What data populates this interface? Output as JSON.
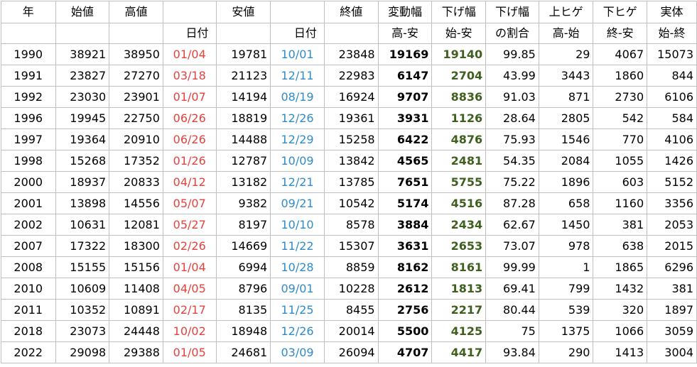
{
  "header": {
    "row1": [
      "年",
      "始値",
      "高値",
      "",
      "安値",
      "",
      "終値",
      "変動幅",
      "下げ幅",
      "下げ幅",
      "上ヒゲ",
      "下ヒゲ",
      "実体"
    ],
    "row2": [
      "",
      "",
      "",
      "日付",
      "",
      "日付",
      "",
      "高-安",
      "始-安",
      "の割合",
      "高-始",
      "終-安",
      "始-終"
    ]
  },
  "rows": [
    [
      "1990",
      "38921",
      "38950",
      "01/04",
      "19781",
      "10/01",
      "23848",
      "19169",
      "19140",
      "99.85",
      "29",
      "4067",
      "15073"
    ],
    [
      "1991",
      "23827",
      "27270",
      "03/18",
      "21123",
      "12/11",
      "22983",
      "6147",
      "2704",
      "43.99",
      "3443",
      "1860",
      "844"
    ],
    [
      "1992",
      "23030",
      "23901",
      "01/07",
      "14194",
      "08/19",
      "16924",
      "9707",
      "8836",
      "91.03",
      "871",
      "2730",
      "6106"
    ],
    [
      "1996",
      "19945",
      "22750",
      "06/26",
      "18819",
      "12/26",
      "19361",
      "3931",
      "1126",
      "28.64",
      "2805",
      "542",
      "584"
    ],
    [
      "1997",
      "19364",
      "20910",
      "06/26",
      "14488",
      "12/29",
      "15258",
      "6422",
      "4876",
      "75.93",
      "1546",
      "770",
      "4106"
    ],
    [
      "1998",
      "15268",
      "17352",
      "01/26",
      "12787",
      "10/09",
      "13842",
      "4565",
      "2481",
      "54.35",
      "2084",
      "1055",
      "1426"
    ],
    [
      "2000",
      "18937",
      "20833",
      "04/12",
      "13182",
      "12/21",
      "13785",
      "7651",
      "5755",
      "75.22",
      "1896",
      "603",
      "5152"
    ],
    [
      "2001",
      "13898",
      "14556",
      "05/07",
      "9382",
      "09/21",
      "10542",
      "5174",
      "4516",
      "87.28",
      "658",
      "1160",
      "3356"
    ],
    [
      "2002",
      "10631",
      "12081",
      "05/27",
      "8197",
      "10/10",
      "8578",
      "3884",
      "2434",
      "62.67",
      "1450",
      "381",
      "2053"
    ],
    [
      "2007",
      "17322",
      "18300",
      "02/26",
      "14669",
      "11/22",
      "15307",
      "3631",
      "2653",
      "73.07",
      "978",
      "638",
      "2015"
    ],
    [
      "2008",
      "15155",
      "15156",
      "01/04",
      "6994",
      "10/28",
      "8859",
      "8162",
      "8161",
      "99.99",
      "1",
      "1865",
      "6296"
    ],
    [
      "2010",
      "10609",
      "11408",
      "04/05",
      "8796",
      "09/01",
      "10228",
      "2612",
      "1813",
      "69.41",
      "799",
      "1432",
      "381"
    ],
    [
      "2011",
      "10352",
      "10891",
      "02/17",
      "8135",
      "11/25",
      "8455",
      "2756",
      "2217",
      "80.44",
      "539",
      "320",
      "1897"
    ],
    [
      "2018",
      "23073",
      "24448",
      "10/02",
      "18948",
      "12/26",
      "20014",
      "5500",
      "4125",
      "75",
      "1375",
      "1066",
      "3059"
    ],
    [
      "2022",
      "29098",
      "29388",
      "01/05",
      "24681",
      "03/09",
      "26094",
      "4707",
      "4417",
      "93.84",
      "290",
      "1413",
      "3004"
    ]
  ],
  "colors": {
    "high_date": "#e8413b",
    "low_date": "#2f8bc9",
    "down_range": "#3f5f1f",
    "grid": "#bfbfbf"
  }
}
